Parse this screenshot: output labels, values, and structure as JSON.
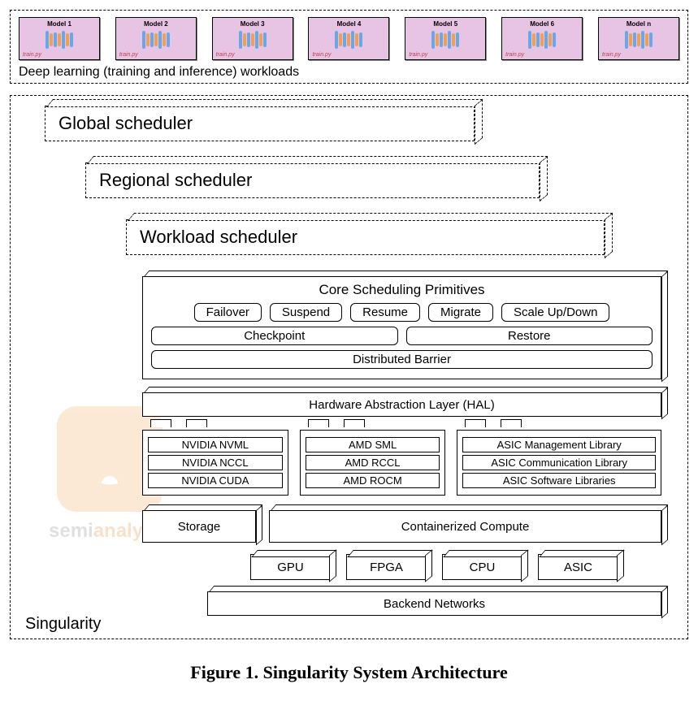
{
  "workloads": {
    "caption": "Deep learning (training and inference) workloads",
    "models": [
      {
        "title": "Model 1",
        "sub": "train.py"
      },
      {
        "title": "Model 2",
        "sub": "train.py"
      },
      {
        "title": "Model 3",
        "sub": "train.py"
      },
      {
        "title": "Model 4",
        "sub": "train.py"
      },
      {
        "title": "Model 5",
        "sub": "train.py"
      },
      {
        "title": "Model 6",
        "sub": "train.py"
      },
      {
        "title": "Model n",
        "sub": "train.py"
      }
    ]
  },
  "system": {
    "label": "Singularity",
    "schedulers": {
      "global": "Global scheduler",
      "regional": "Regional scheduler",
      "workload": "Workload scheduler"
    },
    "core": {
      "title": "Core Scheduling Primitives",
      "row1": [
        "Failover",
        "Suspend",
        "Resume",
        "Migrate",
        "Scale Up/Down"
      ],
      "row2": [
        "Checkpoint",
        "Restore"
      ],
      "row3": [
        "Distributed Barrier"
      ]
    },
    "hal": {
      "title": "Hardware Abstraction Layer (HAL)"
    },
    "libs": {
      "nvidia": [
        "NVIDIA NVML",
        "NVIDIA NCCL",
        "NVIDIA CUDA"
      ],
      "amd": [
        "AMD SML",
        "AMD RCCL",
        "AMD ROCM"
      ],
      "asic": [
        "ASIC Management Library",
        "ASIC Communication Library",
        "ASIC Software Libraries"
      ]
    },
    "storage": "Storage",
    "compute": "Containerized Compute",
    "chips": [
      "GPU",
      "FPGA",
      "CPU",
      "ASIC"
    ],
    "backend": "Backend Networks"
  },
  "figure_caption": "Figure 1. Singularity System Architecture",
  "watermark": {
    "prefix": "semi",
    "suffix": "analysis"
  }
}
